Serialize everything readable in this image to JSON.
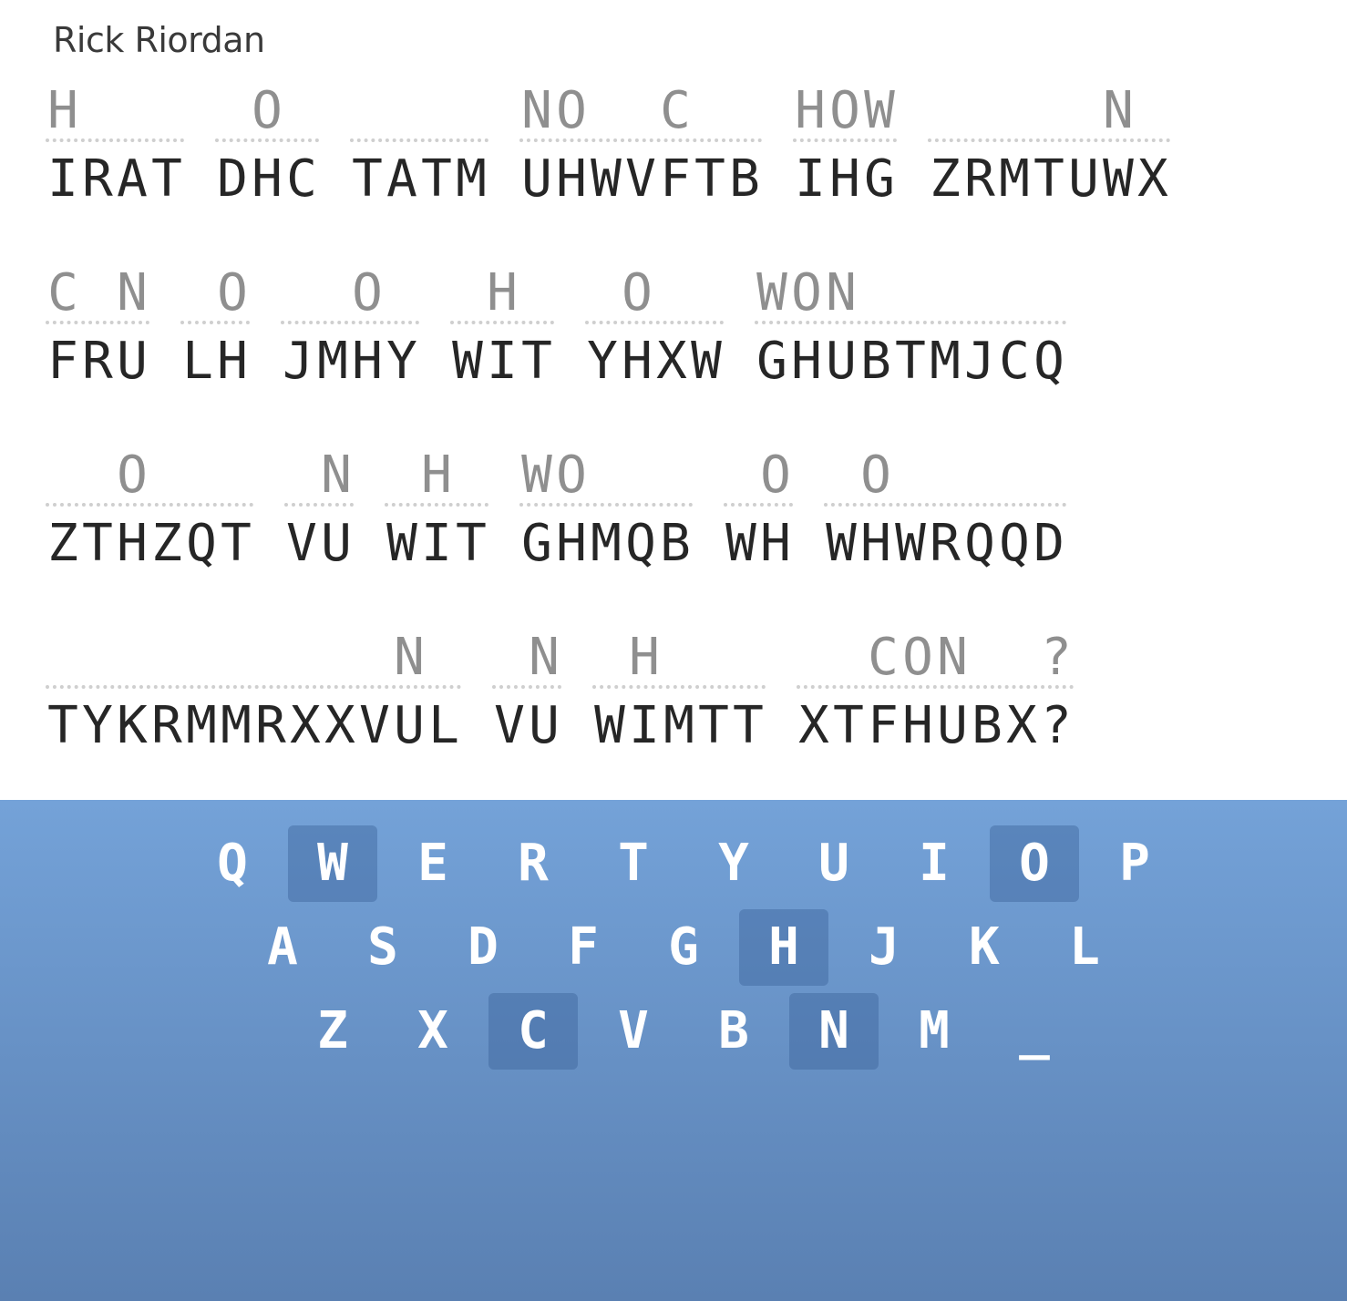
{
  "author": "Rick Riordan",
  "lines": [
    [
      {
        "cipher": "IRAT",
        "guess": "H   "
      },
      {
        "cipher": "DHC",
        "guess": " O "
      },
      {
        "cipher": "TATM",
        "guess": "    "
      },
      {
        "cipher": "UHWVFTB",
        "guess": "NO  C  "
      },
      {
        "cipher": "IHG",
        "guess": "HOW"
      },
      {
        "cipher": "ZRMTUWX",
        "guess": "     N "
      }
    ],
    [
      {
        "cipher": "FRU",
        "guess": "C N"
      },
      {
        "cipher": "LH",
        "guess": " O"
      },
      {
        "cipher": "JMHY",
        "guess": "  O "
      },
      {
        "cipher": "WIT",
        "guess": " H "
      },
      {
        "cipher": "YHXW",
        "guess": " O  "
      },
      {
        "cipher": "GHUBTMJCQ",
        "guess": "WON      "
      }
    ],
    [
      {
        "cipher": "ZTHZQT",
        "guess": "  O   "
      },
      {
        "cipher": "VU",
        "guess": " N"
      },
      {
        "cipher": "WIT",
        "guess": " H "
      },
      {
        "cipher": "GHMQB",
        "guess": "WO   "
      },
      {
        "cipher": "WH",
        "guess": " O"
      },
      {
        "cipher": "WHWRQQD",
        "guess": " O     "
      }
    ],
    [
      {
        "cipher": "TYKRMMRXXVUL",
        "guess": "          N "
      },
      {
        "cipher": "VU",
        "guess": " N"
      },
      {
        "cipher": "WIMTT",
        "guess": " H   "
      },
      {
        "cipher": "XTFHUBX?",
        "guess": "  CON  ?"
      }
    ]
  ],
  "keyboard": {
    "rows": [
      [
        "Q",
        "W",
        "E",
        "R",
        "T",
        "Y",
        "U",
        "I",
        "O",
        "P"
      ],
      [
        "A",
        "S",
        "D",
        "F",
        "G",
        "H",
        "J",
        "K",
        "L"
      ],
      [
        "Z",
        "X",
        "C",
        "V",
        "B",
        "N",
        "M",
        "_"
      ]
    ],
    "used": [
      "W",
      "O",
      "H",
      "C",
      "N"
    ]
  }
}
